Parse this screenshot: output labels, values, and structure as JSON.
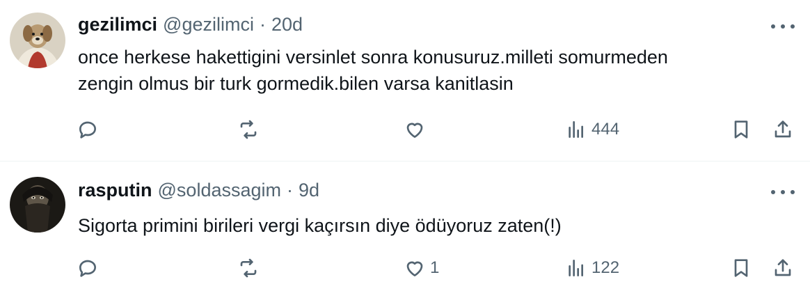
{
  "tweets": [
    {
      "author_name": "gezilimci",
      "author_handle": "@gezilimci",
      "separator": "·",
      "time": "20d",
      "text_lines": [
        "once herkese hakettigini versinlet sonra konusuruz.milleti somurmeden",
        "zengin olmus bir turk gormedik.bilen varsa kanitlasin"
      ],
      "avatar_icon": "dog-in-robe-avatar",
      "stats": {
        "replies": "",
        "retweets": "",
        "likes": "",
        "views": "444"
      }
    },
    {
      "author_name": "rasputin",
      "author_handle": "@soldassagim",
      "separator": "·",
      "time": "9d",
      "text_lines": [
        "Sigorta primini birileri vergi kaçırsın diye ödüyoruz zaten(!)"
      ],
      "avatar_icon": "bearded-man-portrait-avatar",
      "stats": {
        "replies": "",
        "retweets": "",
        "likes": "1",
        "views": "122"
      }
    }
  ],
  "icons": {
    "reply": "reply-icon",
    "retweet": "retweet-icon",
    "like": "heart-icon",
    "views": "views-chart-icon",
    "bookmark": "bookmark-icon",
    "share": "share-icon",
    "more": "more-dots-icon"
  },
  "colors": {
    "text": "#0f1419",
    "secondary": "#536471",
    "divider": "#eff3f4"
  }
}
